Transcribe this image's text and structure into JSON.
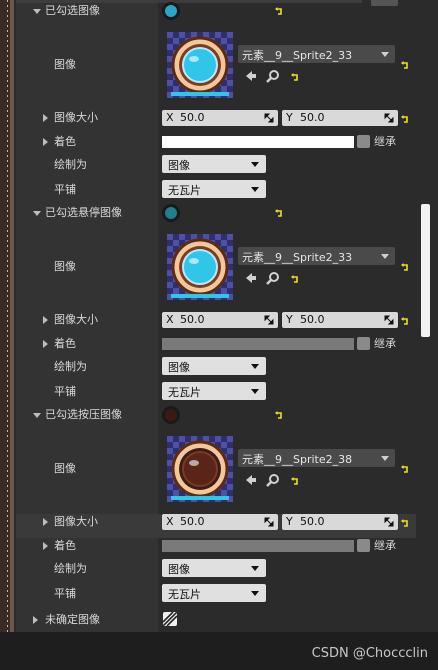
{
  "sections": [
    {
      "title": "已勾选图像",
      "swatch_color": "#29a6c8",
      "image_label": "图像",
      "image_asset": "元素__9__Sprite2_33",
      "image_kind": "blue",
      "size_label": "图像大小",
      "size_x": "50.0",
      "size_y": "50.0",
      "tint_label": "着色",
      "tint_color": "#ffffff",
      "inherit_label": "继承",
      "draw_as_label": "绘制为",
      "draw_as_value": "图像",
      "tiling_label": "平铺",
      "tiling_value": "无瓦片"
    },
    {
      "title": "已勾选悬停图像",
      "swatch_color": "#1f7f8f",
      "image_label": "图像",
      "image_asset": "元素__9__Sprite2_33",
      "image_kind": "blue",
      "size_label": "图像大小",
      "size_x": "50.0",
      "size_y": "50.0",
      "tint_label": "着色",
      "tint_color": "#7a7a7a",
      "inherit_label": "继承",
      "draw_as_label": "绘制为",
      "draw_as_value": "图像",
      "tiling_label": "平铺",
      "tiling_value": "无瓦片"
    },
    {
      "title": "已勾选按压图像",
      "swatch_color": "#3a1a12",
      "image_label": "图像",
      "image_asset": "元素__9__Sprite2_38",
      "image_kind": "brown",
      "size_label": "图像大小",
      "size_x": "50.0",
      "size_y": "50.0",
      "tint_label": "着色",
      "tint_color": "#7a7a7a",
      "inherit_label": "继承",
      "draw_as_label": "绘制为",
      "draw_as_value": "图像",
      "tiling_label": "平铺",
      "tiling_value": "无瓦片"
    }
  ],
  "undetermined": {
    "title": "未确定图像"
  },
  "axis": {
    "x": "X",
    "y": "Y"
  },
  "watermark": "CSDN @Choccclin",
  "icons": {
    "use": "arrow-left-icon",
    "browse": "magnifier-icon",
    "reset": "reset-arrow-icon",
    "drag": "diagonal-arrow-icon"
  },
  "colors": {
    "reset_arrow": "#f0e020",
    "panel": "#2b2b2b",
    "label_column": "#333333"
  }
}
